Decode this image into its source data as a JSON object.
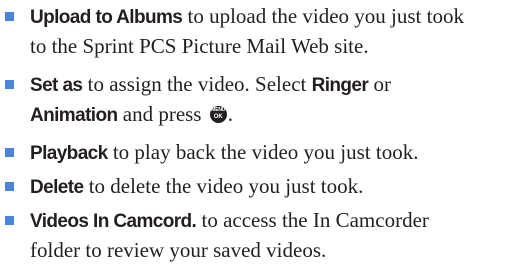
{
  "items": [
    {
      "term": "Upload to Albums",
      "text_line1": " to upload the video you just took",
      "text_line2": "to the Sprint PCS Picture Mail Web site."
    },
    {
      "term": "Set as",
      "text_a": " to assign the video. Select ",
      "term2": "Ringer",
      "text_b": " or",
      "term3": "Animation",
      "text_c": " and press ",
      "icon": "menu-ok-key-icon",
      "icon_top": "MENU",
      "icon_bottom": "OK",
      "text_d": "."
    },
    {
      "term": "Playback",
      "text_line1": " to play back the video you just took."
    },
    {
      "term": "Delete",
      "text_line1": " to delete the video you just took."
    },
    {
      "term": "Videos In Camcord.",
      "text_line1": " to access the In Camcorder",
      "text_line2": "folder to review your saved videos."
    }
  ],
  "colors": {
    "bullet": "#4a86d8",
    "text": "#231f20",
    "background": "#ffffff"
  }
}
